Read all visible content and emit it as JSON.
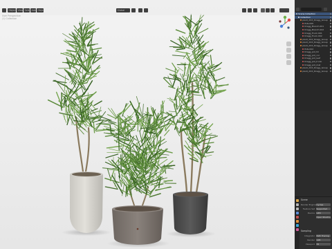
{
  "viewport": {
    "header_buttons": [
      "Object",
      "View",
      "Select",
      "Add",
      "Object"
    ],
    "mode_label": "Global",
    "overlay_lines": [
      "User Perspective",
      "(1) Collection"
    ]
  },
  "outliner": {
    "title": "Scene Collection",
    "rows": [
      {
        "label": "Scene Collection",
        "depth": 0,
        "selected": true,
        "kind": "scene"
      },
      {
        "label": "Collection",
        "depth": 1,
        "selected": true,
        "kind": "collection"
      },
      {
        "label": "plant_XXX_Dragg_Group",
        "depth": 2,
        "selected": false,
        "kind": "object"
      },
      {
        "label": "Pots.000",
        "depth": 3,
        "selected": false,
        "kind": "mesh"
      },
      {
        "label": "Dragg_Branch.001",
        "depth": 3,
        "selected": false,
        "kind": "mesh"
      },
      {
        "label": "Dragg_Branch.002",
        "depth": 3,
        "selected": false,
        "kind": "mesh"
      },
      {
        "label": "Dragg_Trunk.001",
        "depth": 3,
        "selected": false,
        "kind": "mesh"
      },
      {
        "label": "Dragg_Trunk.002",
        "depth": 3,
        "selected": false,
        "kind": "mesh"
      },
      {
        "label": "plant_XXX_Dragg_Group",
        "depth": 2,
        "selected": false,
        "kind": "object"
      },
      {
        "label": "plant_XXX_Dragg_Group",
        "depth": 2,
        "selected": false,
        "kind": "object"
      },
      {
        "label": "plant_XXX_Dragg_Group",
        "depth": 2,
        "selected": false,
        "kind": "object"
      },
      {
        "label": "Pots.002",
        "depth": 3,
        "selected": false,
        "kind": "mesh"
      },
      {
        "label": "Dragg_pot_fol",
        "depth": 3,
        "selected": false,
        "kind": "mesh"
      },
      {
        "label": "Dragg_pot_col",
        "depth": 3,
        "selected": false,
        "kind": "mesh"
      },
      {
        "label": "Dragg_pot_leaf",
        "depth": 3,
        "selected": false,
        "kind": "mesh"
      },
      {
        "label": "Dragg_pot_trunk",
        "depth": 3,
        "selected": false,
        "kind": "mesh"
      },
      {
        "label": "Dragg_pot_mat",
        "depth": 3,
        "selected": false,
        "kind": "mesh"
      },
      {
        "label": "plant_XXX_Dragg_Group",
        "depth": 2,
        "selected": false,
        "kind": "object"
      },
      {
        "label": "plant_XXX_Dragg_Group",
        "depth": 2,
        "selected": false,
        "kind": "object"
      }
    ]
  },
  "properties": {
    "section_title": "Scene",
    "fields": [
      {
        "label": "Render Engine",
        "value": "Cycles"
      },
      {
        "label": "Feature Set",
        "value": "Supported"
      },
      {
        "label": "Device",
        "value": "GPU"
      },
      {
        "label": "",
        "value": "Open Shading Language"
      }
    ],
    "subsection_title": "Sampling",
    "sampling_fields": [
      {
        "label": "Integrator",
        "value": "Path Tracing"
      },
      {
        "label": "Render",
        "value": "128"
      },
      {
        "label": "Viewport",
        "value": "32"
      }
    ]
  },
  "colors": {
    "selection": "#3b5479",
    "foliage": "#4f7a32",
    "pot_white": "#d8d6d0",
    "pot_taupe": "#7d7570",
    "pot_dark": "#4a4a4a"
  }
}
